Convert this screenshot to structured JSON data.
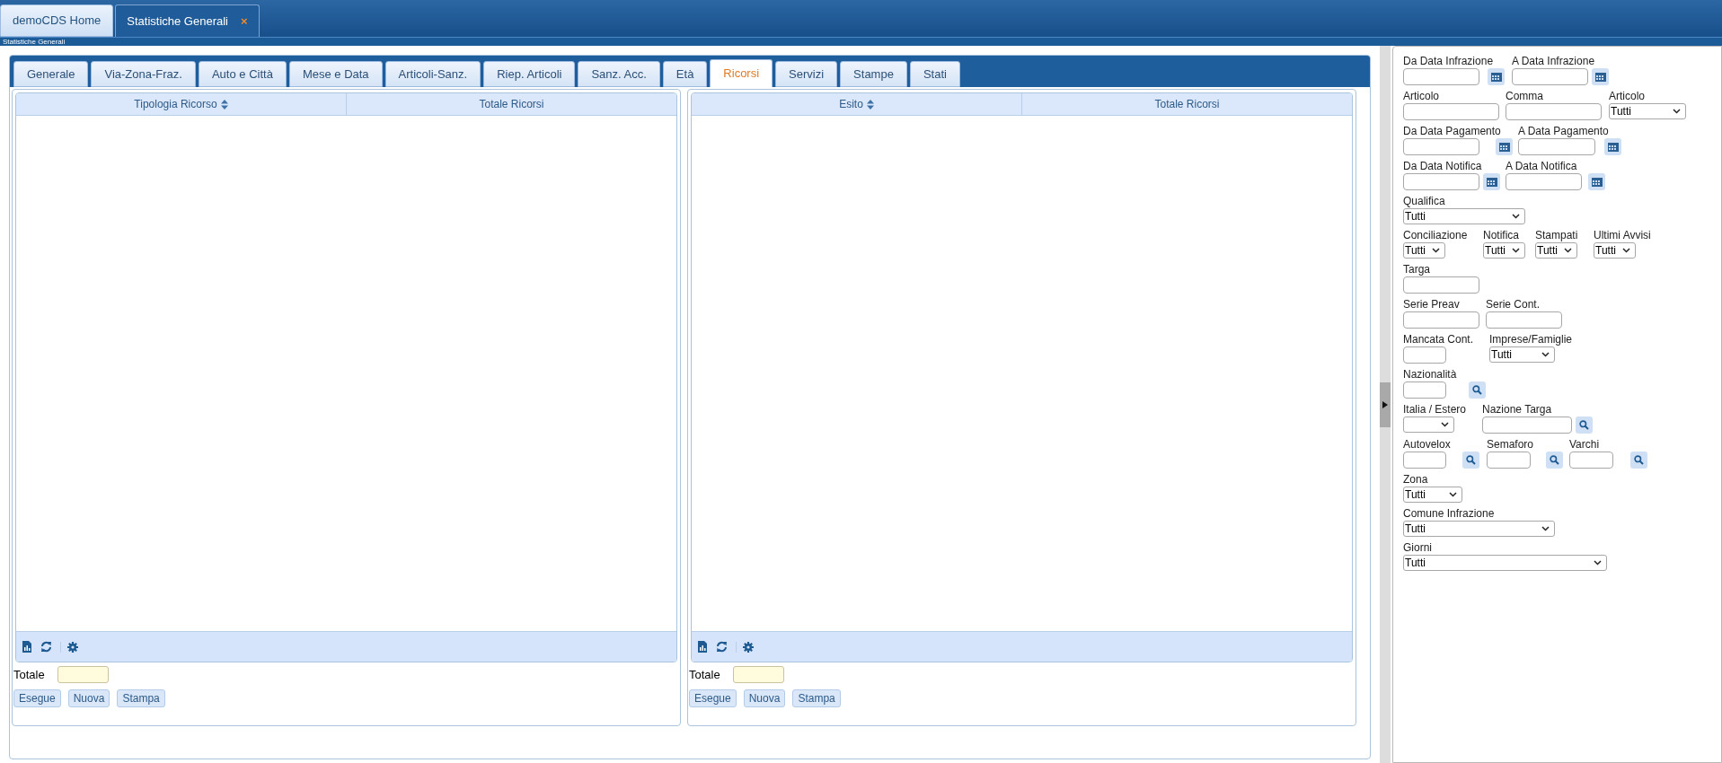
{
  "window_tabs": [
    {
      "label": "demoCDS Home",
      "selected": false
    },
    {
      "label": "Statistiche Generali",
      "selected": true,
      "close": "×"
    }
  ],
  "breadcrumb": "Statistiche Generali",
  "tabs": [
    {
      "label": "Generale",
      "selected": false
    },
    {
      "label": "Via-Zona-Fraz.",
      "selected": false
    },
    {
      "label": "Auto e Città",
      "selected": false
    },
    {
      "label": "Mese e Data",
      "selected": false
    },
    {
      "label": "Articoli-Sanz.",
      "selected": false
    },
    {
      "label": "Riep. Articoli",
      "selected": false
    },
    {
      "label": "Sanz. Acc.",
      "selected": false
    },
    {
      "label": "Età",
      "selected": false
    },
    {
      "label": "Ricorsi",
      "selected": true
    },
    {
      "label": "Servizi",
      "selected": false
    },
    {
      "label": "Stampe",
      "selected": false
    },
    {
      "label": "Stati",
      "selected": false
    }
  ],
  "grids": [
    {
      "columns": [
        {
          "label": "Tipologia Ricorso",
          "sorted": true
        },
        {
          "label": "Totale Ricorsi",
          "sorted": false
        }
      ],
      "total_label": "Totale",
      "buttons": [
        "Esegue",
        "Nuova",
        "Stampa"
      ]
    },
    {
      "columns": [
        {
          "label": "Esito",
          "sorted": true
        },
        {
          "label": "Totale Ricorsi",
          "sorted": false
        }
      ],
      "total_label": "Totale",
      "buttons": [
        "Esegue",
        "Nuova",
        "Stampa"
      ]
    }
  ],
  "filters": [
    [
      {
        "label": "Da Data Infrazione",
        "kind": "date"
      },
      {
        "label": "A Data Infrazione",
        "kind": "date"
      }
    ],
    [
      {
        "label": "Articolo",
        "kind": "text"
      },
      {
        "label": "Comma",
        "kind": "text"
      },
      {
        "label": "Articolo",
        "kind": "select",
        "value": "Tutti"
      }
    ],
    [
      {
        "label": "Da Data Pagamento",
        "kind": "date"
      },
      {
        "label": "A Data Pagamento",
        "kind": "date"
      }
    ],
    [
      {
        "label": "Da Data Notifica",
        "kind": "date"
      },
      {
        "label": "A Data Notifica",
        "kind": "date"
      }
    ],
    [
      {
        "label": "Qualifica",
        "kind": "select",
        "value": "Tutti"
      }
    ],
    [
      {
        "label": "Conciliazione",
        "kind": "select",
        "value": "Tutti"
      },
      {
        "label": "Notifica",
        "kind": "select",
        "value": "Tutti"
      },
      {
        "label": "Stampati",
        "kind": "select",
        "value": "Tutti"
      },
      {
        "label": "Ultimi Avvisi",
        "kind": "select",
        "value": "Tutti"
      }
    ],
    [
      {
        "label": "Targa",
        "kind": "text"
      }
    ],
    [
      {
        "label": "Serie Preav",
        "kind": "text"
      },
      {
        "label": "Serie Cont.",
        "kind": "text"
      }
    ],
    [
      {
        "label": "Mancata Cont.",
        "kind": "text"
      },
      {
        "label": "Imprese/Famiglie",
        "kind": "select",
        "value": "Tutti"
      }
    ],
    [
      {
        "label": "Nazionalità",
        "kind": "lookup"
      }
    ],
    [
      {
        "label": "Italia / Estero",
        "kind": "select"
      },
      {
        "label": "Nazione Targa",
        "kind": "lookup"
      }
    ],
    [
      {
        "label": "Autovelox",
        "kind": "lookup"
      },
      {
        "label": "Semaforo",
        "kind": "lookup"
      },
      {
        "label": "Varchi",
        "kind": "lookup"
      }
    ],
    [
      {
        "label": "Zona",
        "kind": "select",
        "value": "Tutti"
      }
    ],
    [
      {
        "label": "Comune Infrazione",
        "kind": "select",
        "value": "Tutti"
      }
    ],
    [
      {
        "label": "Giorni",
        "kind": "select",
        "value": "Tutti"
      }
    ]
  ]
}
